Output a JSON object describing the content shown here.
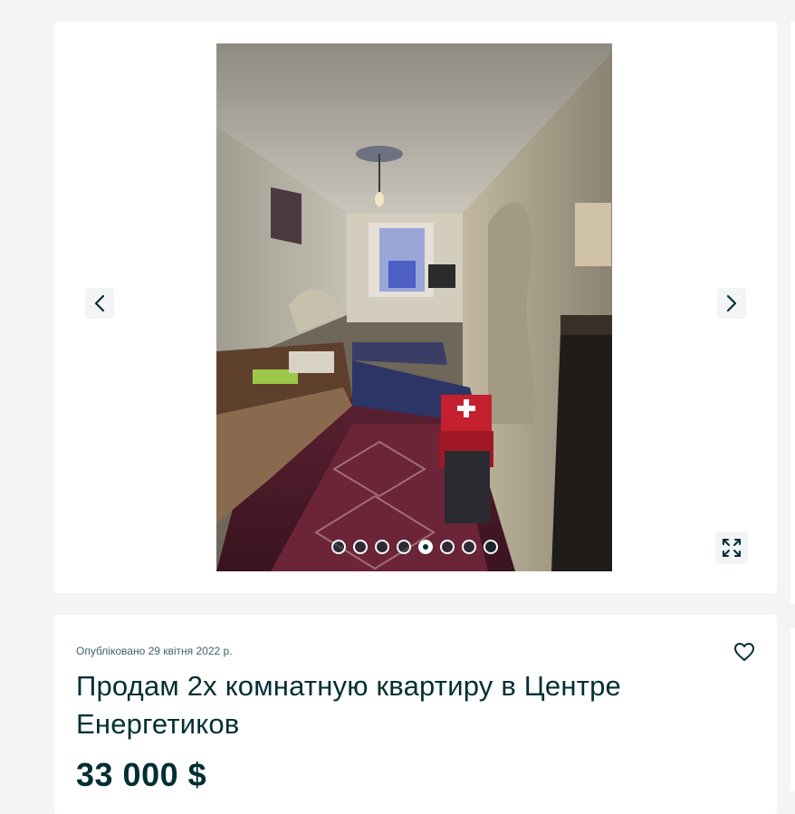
{
  "gallery": {
    "photo_alt": "",
    "slide_count": 8,
    "active_slide": 4,
    "prev_icon": "chevron-left-icon",
    "next_icon": "chevron-right-icon",
    "fullscreen_icon": "expand-icon"
  },
  "listing": {
    "published": "Опубліковано 29 квітня 2022 р.",
    "title": "Продам 2х комнатную квартиру в Центре Енергетиков",
    "price": "33 000 $",
    "favorite_icon": "heart-outline-icon"
  },
  "colors": {
    "text": "#002f34",
    "background": "#f2f4f5",
    "card": "#ffffff"
  }
}
